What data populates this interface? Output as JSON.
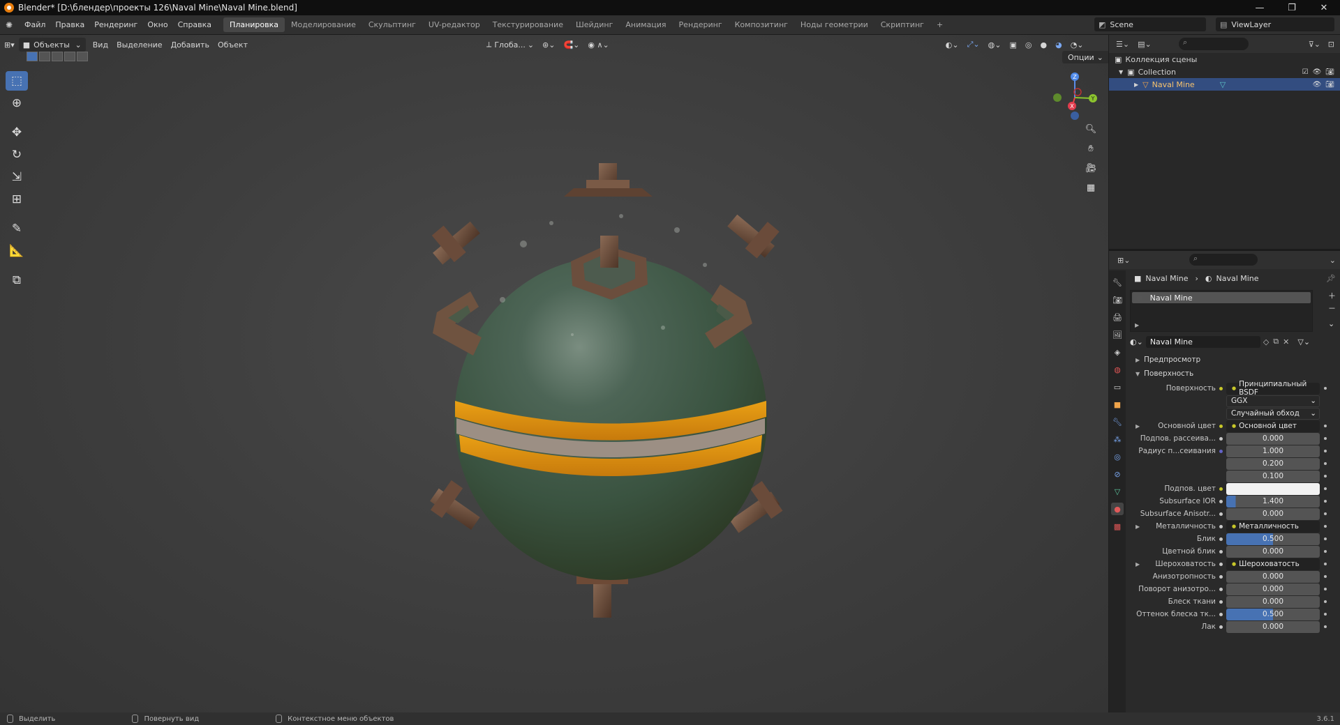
{
  "window": {
    "title": "Blender* [D:\\блендер\\проекты 126\\Naval Mine\\Naval Mine.blend]",
    "minimize": "—",
    "restore": "❐",
    "close": "✕"
  },
  "menu": [
    "Файл",
    "Правка",
    "Рендеринг",
    "Окно",
    "Справка"
  ],
  "workspaces": [
    "Планировка",
    "Моделирование",
    "Скульптинг",
    "UV-редактор",
    "Текстурирование",
    "Шейдинг",
    "Анимация",
    "Рендеринг",
    "Композитинг",
    "Ноды геометрии",
    "Скриптинг",
    "+"
  ],
  "active_workspace": "Планировка",
  "scene": "Scene",
  "view_layer": "ViewLayer",
  "viewport": {
    "mode": "Объекты",
    "menus": [
      "Вид",
      "Выделение",
      "Добавить",
      "Объект"
    ],
    "transform_orientation": "Глоба...",
    "options": "Опции",
    "gizmo_labels": {
      "z": "Z",
      "y": "Y",
      "x": "X"
    }
  },
  "outliner": {
    "scene_collection": "Коллекция сцены",
    "collection": "Collection",
    "object": "Naval Mine"
  },
  "properties": {
    "breadcrumb_object": "Naval Mine",
    "breadcrumb_material": "Naval Mine",
    "material_slot": "Naval Mine",
    "material_name": "Naval Mine",
    "preview_section": "Предпросмотр",
    "surface_section": "Поверхность",
    "rows": [
      {
        "label": "Поверхность",
        "value": "Принципиальный BSDF",
        "kind": "link",
        "dot": "y"
      },
      {
        "label": "",
        "value": "GGX",
        "kind": "dd"
      },
      {
        "label": "",
        "value": "Случайный обход",
        "kind": "dd"
      },
      {
        "label": "Основной цвет",
        "value": "Основной цвет",
        "kind": "link",
        "dot": "y",
        "expand": true
      },
      {
        "label": "Подпов. рассеива...",
        "value": "0.000",
        "kind": "num",
        "dot": "g"
      },
      {
        "label": "Радиус п...сеивания",
        "value": "1.000",
        "kind": "num",
        "dot": "b"
      },
      {
        "label": "",
        "value": "0.200",
        "kind": "num"
      },
      {
        "label": "",
        "value": "0.100",
        "kind": "num"
      },
      {
        "label": "Подпов. цвет",
        "value": "",
        "kind": "white",
        "dot": "y"
      },
      {
        "label": "Subsurface IOR",
        "value": "1.400",
        "kind": "num",
        "dot": "g",
        "fill": 0.1
      },
      {
        "label": "Subsurface Anisotr...",
        "value": "0.000",
        "kind": "num",
        "dot": "g"
      },
      {
        "label": "Металличность",
        "value": "Металличность",
        "kind": "link",
        "dot": "g",
        "expand": true
      },
      {
        "label": "Блик",
        "value": "0.500",
        "kind": "num",
        "dot": "g",
        "fill": 0.5
      },
      {
        "label": "Цветной блик",
        "value": "0.000",
        "kind": "num",
        "dot": "g"
      },
      {
        "label": "Шероховатость",
        "value": "Шероховатость",
        "kind": "link",
        "dot": "g",
        "expand": true
      },
      {
        "label": "Анизотропность",
        "value": "0.000",
        "kind": "num",
        "dot": "g"
      },
      {
        "label": "Поворот анизотро...",
        "value": "0.000",
        "kind": "num",
        "dot": "g"
      },
      {
        "label": "Блеск ткани",
        "value": "0.000",
        "kind": "num",
        "dot": "g"
      },
      {
        "label": "Оттенок блеска тк...",
        "value": "0.500",
        "kind": "num",
        "dot": "g",
        "fill": 0.5
      },
      {
        "label": "Лак",
        "value": "0.000",
        "kind": "num",
        "dot": "g"
      }
    ]
  },
  "status": {
    "select": "Выделить",
    "rotate": "Повернуть вид",
    "context": "Контекстное меню объектов",
    "version": "3.6.1"
  },
  "colors": {
    "accent": "#4772b3",
    "selection_row": "#334d80",
    "mine_body": "#3e5a46",
    "mine_band": "#e0920f"
  }
}
